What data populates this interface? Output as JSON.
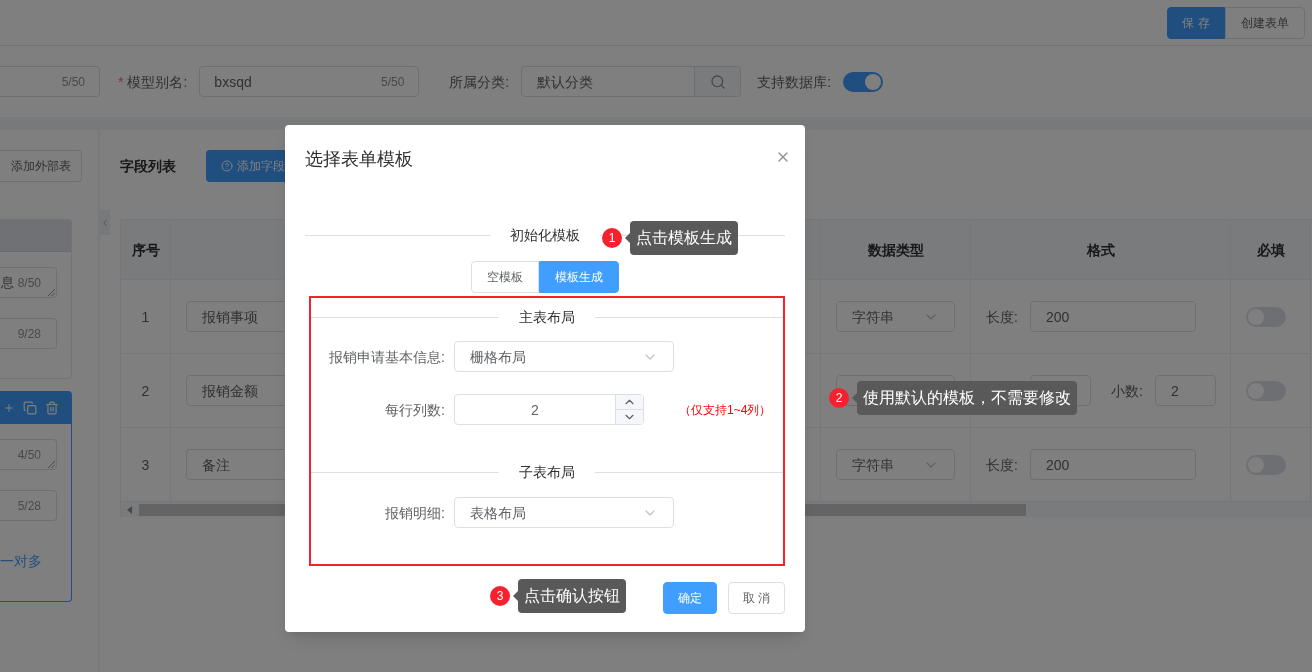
{
  "header": {
    "buttons": [
      {
        "label": "保 存",
        "kind": "primary"
      },
      {
        "label": "创建表单",
        "kind": "default"
      }
    ]
  },
  "model_form": {
    "fields": [
      {
        "kind": "text",
        "counter": "5/50"
      },
      {
        "kind": "text",
        "required_mark": "*",
        "label": "模型别名:",
        "value": "bxsqd",
        "counter": "5/50"
      },
      {
        "kind": "search",
        "label": "所属分类:",
        "value": "默认分类"
      },
      {
        "kind": "switch",
        "label": "支持数据库:",
        "on": true
      }
    ]
  },
  "side_panel": {
    "add_button": "添加外部表",
    "tables": [
      {
        "selected": false,
        "fields": [
          {
            "kind": "textarea",
            "value": "息",
            "counter": "8/50"
          },
          {
            "kind": "input",
            "counter": "9/28"
          }
        ]
      },
      {
        "selected": true,
        "fields": [
          {
            "kind": "textarea",
            "counter": "4/50"
          },
          {
            "kind": "input",
            "counter": "5/28"
          }
        ],
        "relation": "一对多"
      }
    ]
  },
  "fields_panel": {
    "title": "字段列表",
    "add_button": "添加字段",
    "columns": [
      "序号",
      "数据类型",
      "格式",
      "必填"
    ],
    "rows": [
      {
        "index": "1",
        "name": "报销事项",
        "data_type": "字符串",
        "format": {
          "kind": "length",
          "label": "长度:",
          "value": "200"
        },
        "required": false
      },
      {
        "index": "2",
        "name": "报销金额",
        "format": {
          "kind": "decimal",
          "decimal_label": "小数:",
          "decimal_value": "2"
        },
        "required": false
      },
      {
        "index": "3",
        "name": "备注",
        "data_type": "字符串",
        "format": {
          "kind": "length",
          "label": "长度:",
          "value": "200"
        },
        "required": false
      }
    ]
  },
  "dialog": {
    "title": "选择表单模板",
    "section": "初始化模板",
    "options": [
      {
        "label": "空模板",
        "selected": false
      },
      {
        "label": "模板生成",
        "selected": true
      }
    ],
    "main_layout": {
      "title": "主表布局",
      "fields": [
        {
          "kind": "select",
          "label": "报销申请基本信息:",
          "value": "栅格布局"
        },
        {
          "kind": "number",
          "label": "每行列数:",
          "value": "2",
          "hint": "（仅支持1~4列）"
        }
      ]
    },
    "sub_layout": {
      "title": "子表布局",
      "fields": [
        {
          "kind": "select",
          "label": "报销明细:",
          "value": "表格布局"
        }
      ]
    },
    "buttons": [
      {
        "label": "确定",
        "kind": "primary"
      },
      {
        "label": "取 消",
        "kind": "default"
      }
    ]
  },
  "annotations": [
    {
      "number": "1",
      "text": "点击模板生成"
    },
    {
      "number": "2",
      "text": "使用默认的模板，不需要修改"
    },
    {
      "number": "3",
      "text": "点击确认按钮"
    }
  ]
}
